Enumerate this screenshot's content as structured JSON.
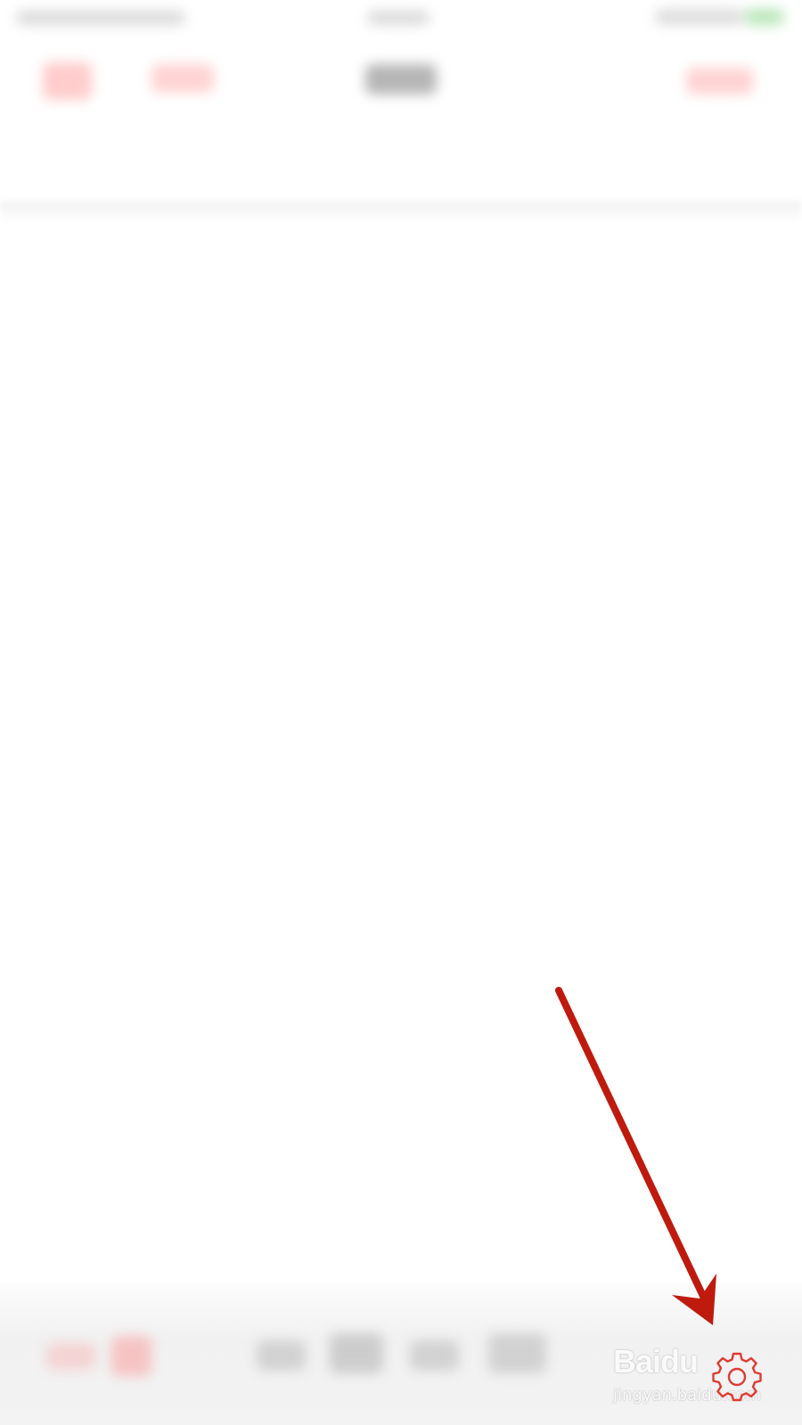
{
  "watermark": {
    "logo_text": "Baidu",
    "url_text": "jingyan.baidu.com"
  },
  "icons": {
    "settings": "gear-icon",
    "annotation": "red-arrow"
  },
  "colors": {
    "annotation_red": "#bf1a0e",
    "gear_red": "#e03a32",
    "toolbar_bg": "#f2f2f2"
  }
}
